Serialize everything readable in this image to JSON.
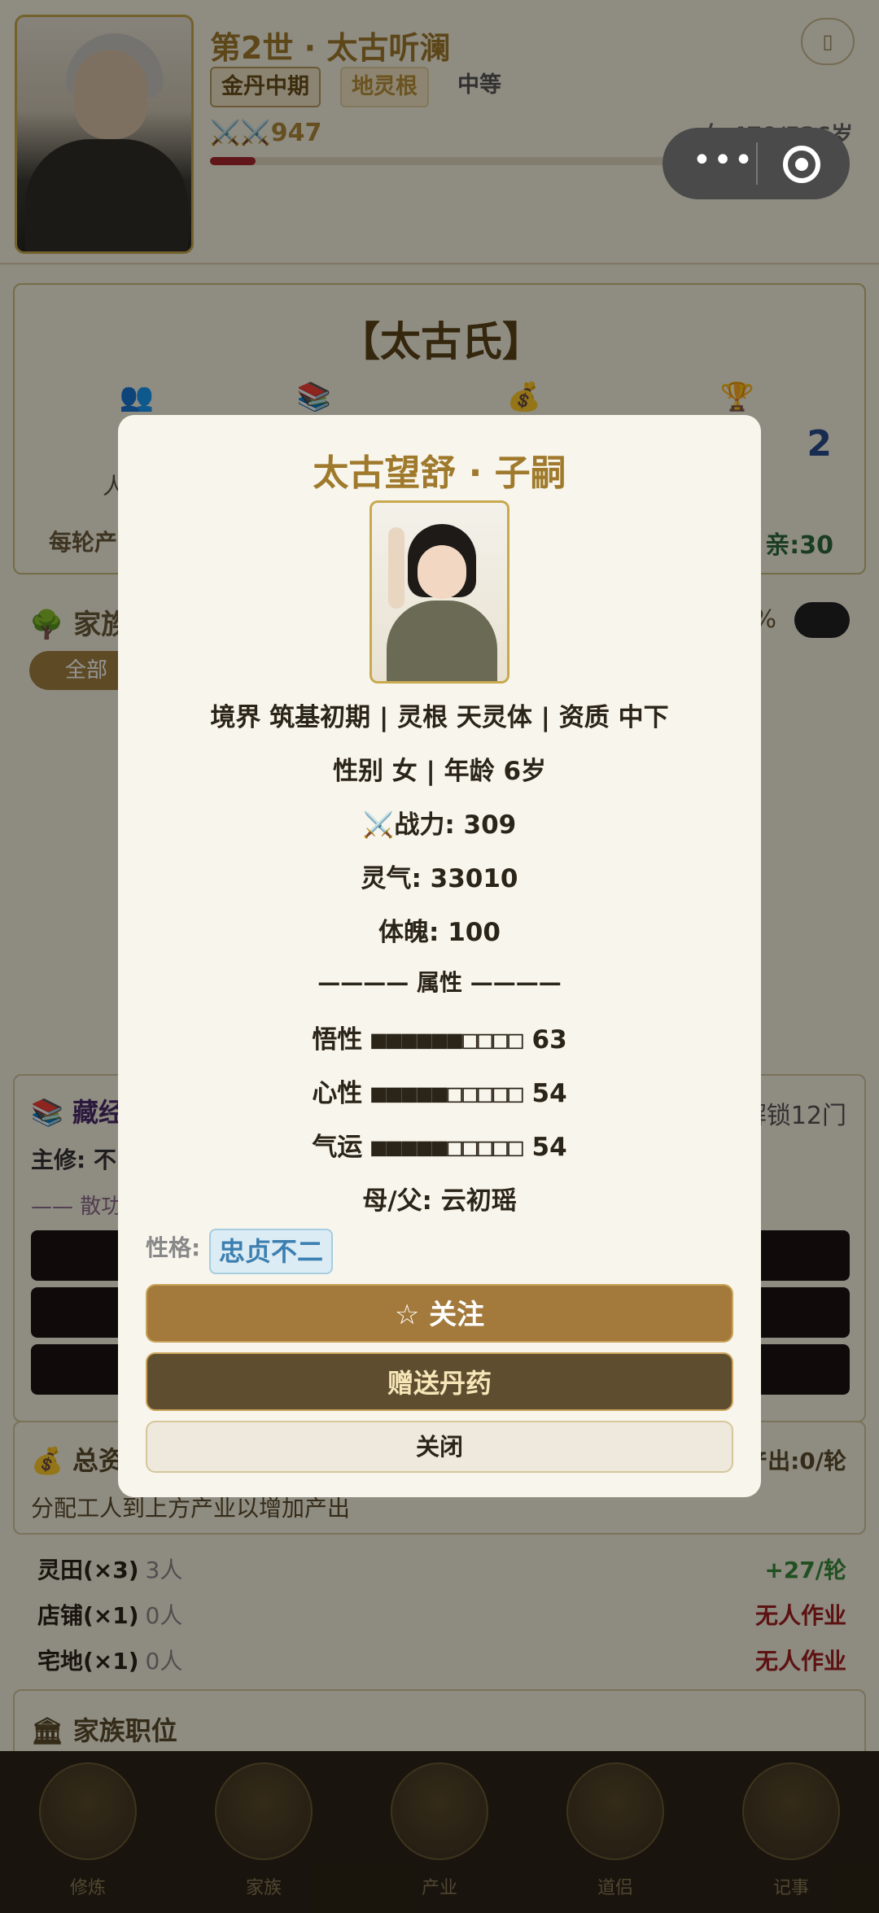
{
  "header": {
    "title": "第2世 · 太古听澜",
    "badges": [
      "金丹中期",
      "地灵根",
      "中等"
    ],
    "power": "⚔️⚔️947",
    "hp_fraction": 0.1,
    "age": "女 470/526岁",
    "top_icon": "bar-icon"
  },
  "miniprogram": {
    "menu_label": "•••",
    "close_icon": "target-icon"
  },
  "clan": {
    "title": "【太古氏】",
    "stat_icons": [
      "people-icon",
      "book-icon",
      "money-bag-icon",
      "trophy-icon"
    ],
    "stat_labels": [
      "人",
      "",
      "",
      ""
    ],
    "right_value": "2",
    "production_label": "每轮产",
    "affinity": "亲:30"
  },
  "tree": {
    "title": "家族",
    "filter_all": "全部",
    "percent": "%"
  },
  "library": {
    "title": "藏经",
    "unlock": "解锁12门",
    "main_skill": "主修: 不",
    "san_label": "—— 散功"
  },
  "resources": {
    "title": "总资",
    "output": "产出:0/轮",
    "hint": "分配工人到上方产业以增加产出",
    "rows": [
      {
        "name": "灵田(×3)",
        "workers": "3人",
        "status": "+27/轮",
        "status_color": "#3a8a3a"
      },
      {
        "name": "店铺(×1)",
        "workers": "0人",
        "status": "无人作业",
        "status_color": "#a02020"
      },
      {
        "name": "宅地(×1)",
        "workers": "0人",
        "status": "无人作业",
        "status_color": "#a02020"
      }
    ]
  },
  "positions": {
    "title": "家族职位"
  },
  "nav": {
    "items": [
      "修炼",
      "家族",
      "产业",
      "道侣",
      "记事"
    ]
  },
  "modal": {
    "title": "太古望舒 · 子嗣",
    "line1": "境界 筑基初期 | 灵根 天灵体 | 资质 中下",
    "line2": "性别 女 | 年龄 6岁",
    "combat_icon": "⚔️",
    "combat": "战力: 309",
    "qi": "灵气: 33010",
    "physique": "体魄: 100",
    "section": "———— 属性 ————",
    "attributes": [
      {
        "name": "悟性",
        "bars": "■■■■■■□□□□",
        "value": "63"
      },
      {
        "name": "心性",
        "bars": "■■■■■□□□□□",
        "value": "54"
      },
      {
        "name": "气运",
        "bars": "■■■■■□□□□□",
        "value": "54"
      }
    ],
    "parent": "母/父: 云初瑶",
    "personality_label": "性格:",
    "personality": "忠贞不二",
    "follow_button": "☆ 关注",
    "gift_button": "赠送丹药",
    "close_button": "关闭"
  },
  "colors": {
    "accent": "#a07a2c",
    "overlay": "rgba(0,0,0,0.42)",
    "button_gold": "#a37a3c",
    "button_dark": "#5f4d30"
  }
}
